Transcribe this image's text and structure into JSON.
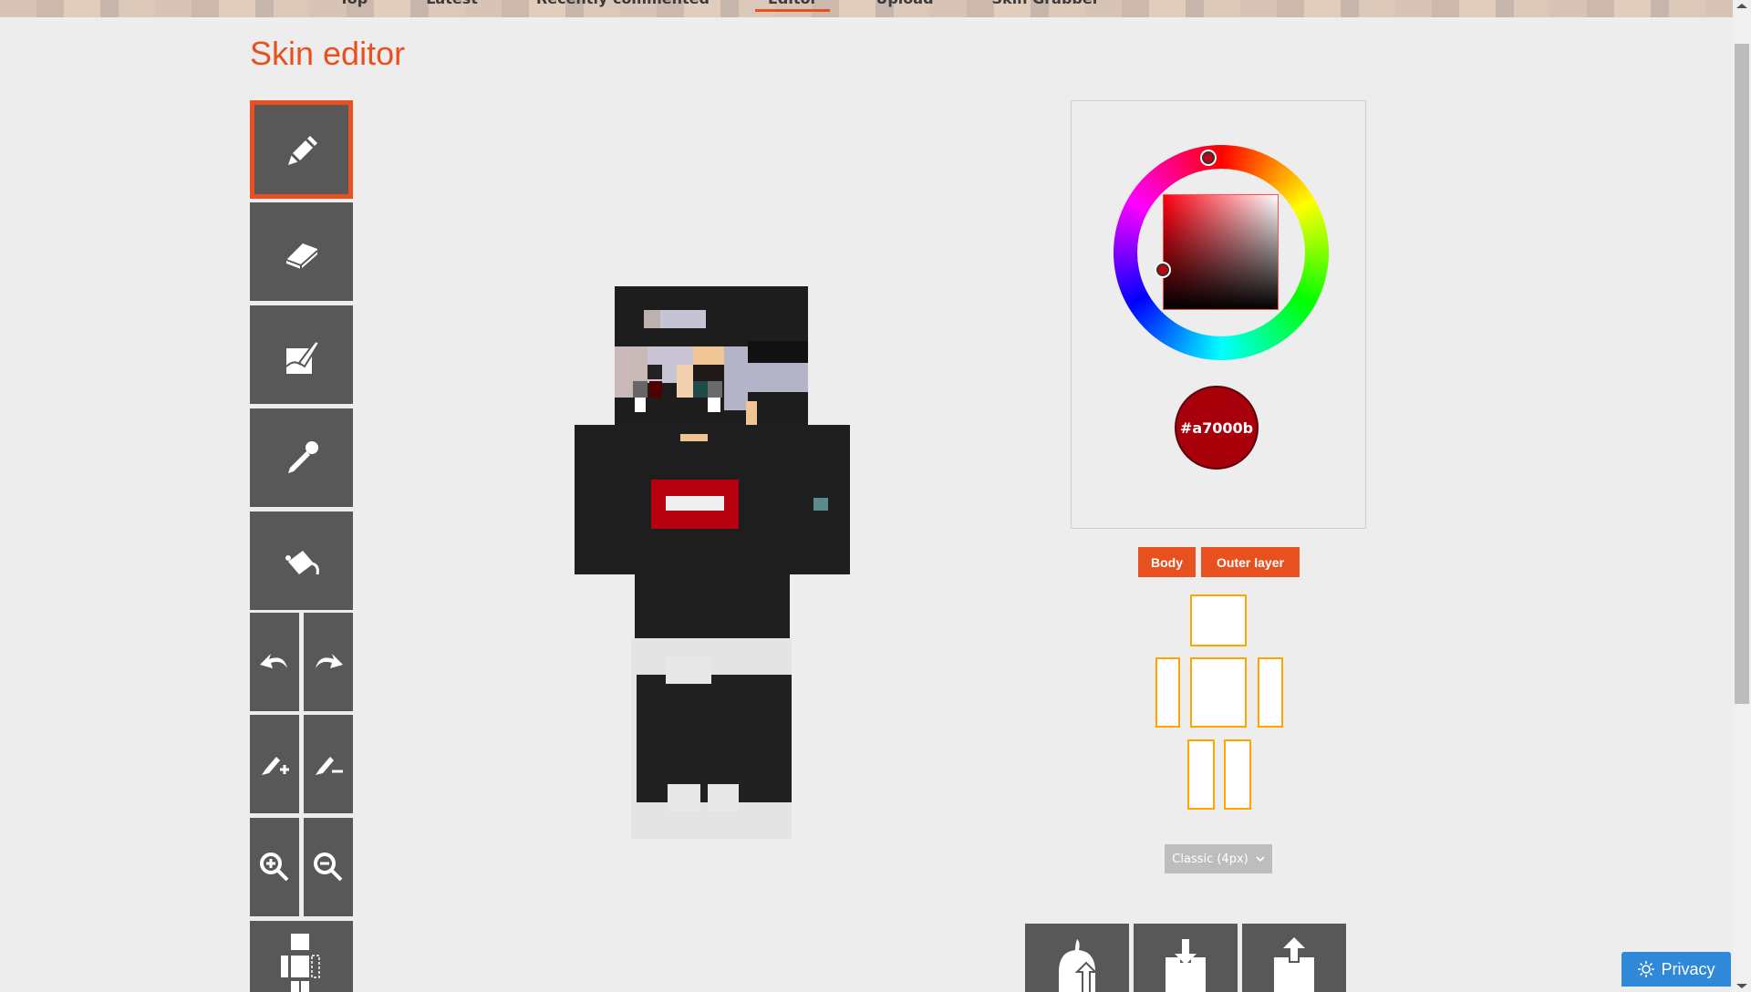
{
  "nav": {
    "items": [
      {
        "label": "Top",
        "active": false
      },
      {
        "label": "Latest",
        "active": false
      },
      {
        "label": "Recently commented",
        "active": false
      },
      {
        "label": "Editor",
        "active": true
      },
      {
        "label": "Upload",
        "active": false
      },
      {
        "label": "Skin Grabber",
        "active": false
      }
    ]
  },
  "page": {
    "title": "Skin editor"
  },
  "toolbar": {
    "tools": [
      {
        "name": "pencil",
        "icon": "pencil-icon",
        "active": true
      },
      {
        "name": "eraser",
        "icon": "eraser-icon",
        "active": false
      },
      {
        "name": "paint-brush",
        "icon": "brush-icon",
        "active": false
      },
      {
        "name": "color-picker",
        "icon": "eyedropper-icon",
        "active": false
      },
      {
        "name": "bucket-fill",
        "icon": "paint-bucket-icon",
        "active": false
      }
    ],
    "pairs": [
      [
        "undo-icon",
        "redo-icon"
      ],
      [
        "lighten-icon",
        "darken-icon"
      ],
      [
        "zoom-in-icon",
        "zoom-out-icon"
      ]
    ],
    "last": "toggle-parts-icon"
  },
  "color": {
    "hex": "#a7000b",
    "hue_degrees": 356
  },
  "layers": {
    "body_label": "Body",
    "outer_label": "Outer layer"
  },
  "body_parts": [
    "head",
    "right-arm",
    "torso",
    "left-arm",
    "right-leg",
    "left-leg"
  ],
  "model_type": {
    "selected": "Classic (4px)"
  },
  "actions": [
    "upload-to-skindex-icon",
    "download-icon",
    "upload-icon"
  ],
  "privacy": {
    "label": "Privacy"
  },
  "colors": {
    "accent": "#e8501f",
    "tool_bg": "#585858",
    "part_border": "#ffa500",
    "privacy_bg": "#2f88d8"
  }
}
